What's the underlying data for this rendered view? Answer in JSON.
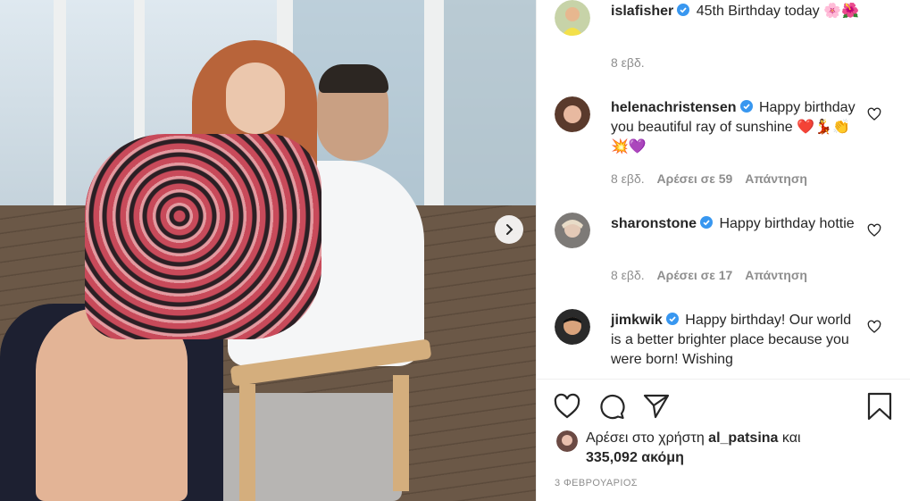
{
  "post": {
    "caption": {
      "username": "islafisher",
      "text": "45th Birthday today 🌸🌺",
      "time": "8 εβδ."
    },
    "comments": [
      {
        "username": "helenachristensen",
        "text": "Happy birthday you beautiful ray of sunshine ❤️💃👏💥💜",
        "time": "8 εβδ.",
        "likes": "Αρέσει σε 59",
        "reply": "Απάντηση"
      },
      {
        "username": "sharonstone",
        "text": "Happy birthday hottie",
        "time": "8 εβδ.",
        "likes": "Αρέσει σε 17",
        "reply": "Απάντηση"
      },
      {
        "username": "jimkwik",
        "text": "Happy birthday! Our world is a better brighter place because you were born! Wishing",
        "time": "",
        "likes": "",
        "reply": ""
      }
    ],
    "likes_prefix": "Αρέσει στο χρήστη",
    "likes_user": "al_patsina",
    "likes_and": "και",
    "likes_count": "335,092 ακόμη",
    "date": "3 ΦΕΒΡΟΥΑΡΙΟΣ"
  },
  "icons": {
    "verified": "verified-badge-icon",
    "heart": "heart-icon",
    "comment": "comment-icon",
    "share": "share-icon",
    "save": "bookmark-icon",
    "next": "chevron-right-icon"
  },
  "colors": {
    "verified": "#3897f0",
    "meta": "#8e8e8e",
    "text": "#262626"
  }
}
